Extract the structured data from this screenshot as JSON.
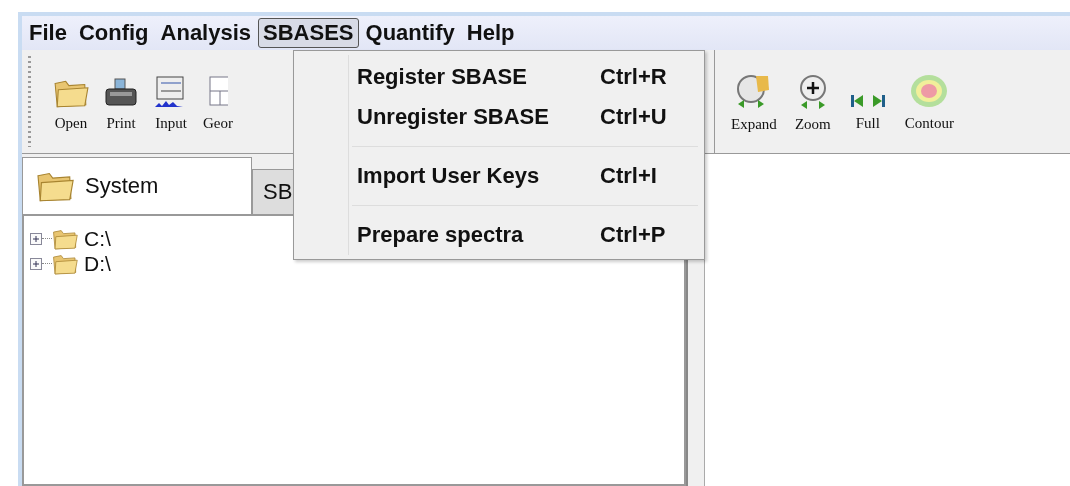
{
  "menubar": [
    {
      "label": "File",
      "selected": false
    },
    {
      "label": "Config",
      "selected": false
    },
    {
      "label": "Analysis",
      "selected": false
    },
    {
      "label": "SBASES",
      "selected": true
    },
    {
      "label": "Quantify",
      "selected": false
    },
    {
      "label": "Help",
      "selected": false
    }
  ],
  "toolbar_left": [
    {
      "kind": "open",
      "label": "Open"
    },
    {
      "kind": "print",
      "label": "Print"
    },
    {
      "kind": "input",
      "label": "Input"
    },
    {
      "kind": "geometry",
      "label": "Geor"
    }
  ],
  "toolbar_right": [
    {
      "kind": "expand",
      "label": "Expand"
    },
    {
      "kind": "zoom",
      "label": "Zoom"
    },
    {
      "kind": "full",
      "label": "Full"
    },
    {
      "kind": "contour",
      "label": "Contour"
    }
  ],
  "tabs": [
    {
      "label": "System",
      "selected": true,
      "icon": true
    },
    {
      "label": "SB",
      "selected": false,
      "icon": false
    }
  ],
  "tree": [
    {
      "label": "C:\\",
      "expanded": false
    },
    {
      "label": "D:\\",
      "expanded": false
    }
  ],
  "menu": {
    "groups": [
      [
        {
          "label": "Register SBASE",
          "shortcut": "Ctrl+R"
        },
        {
          "label": "Unregister SBASE",
          "shortcut": "Ctrl+U"
        }
      ],
      [
        {
          "label": "Import User Keys",
          "shortcut": "Ctrl+I"
        }
      ],
      [
        {
          "label": "Prepare spectra",
          "shortcut": "Ctrl+P"
        }
      ]
    ]
  }
}
